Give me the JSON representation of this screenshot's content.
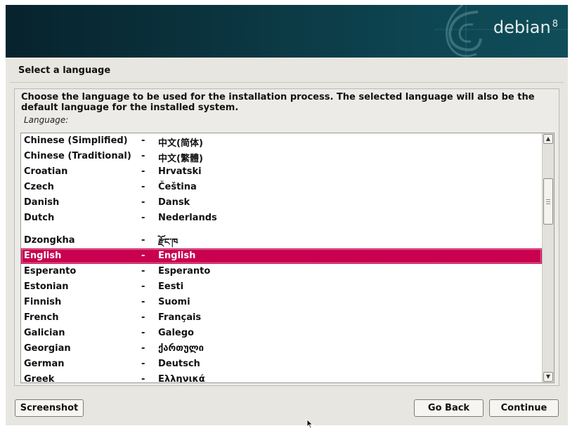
{
  "header": {
    "brand": "debian",
    "version": "8"
  },
  "page": {
    "title": "Select a language"
  },
  "prompt": {
    "instructions": "Choose the language to be used for the installation process. The selected language will also be the default language for the installed system.",
    "field_label": "Language:"
  },
  "languages": [
    {
      "name": "Chinese (Simplified)",
      "sep": "-",
      "native": "中文(简体)"
    },
    {
      "name": "Chinese (Traditional)",
      "sep": "-",
      "native": "中文(繁體)"
    },
    {
      "name": "Croatian",
      "sep": "-",
      "native": "Hrvatski"
    },
    {
      "name": "Czech",
      "sep": "-",
      "native": "Čeština"
    },
    {
      "name": "Danish",
      "sep": "-",
      "native": "Dansk"
    },
    {
      "name": "Dutch",
      "sep": "-",
      "native": "Nederlands"
    },
    {
      "name": "Dzongkha",
      "sep": "-",
      "native": "རྫོང་ཁ"
    },
    {
      "name": "English",
      "sep": "-",
      "native": "English"
    },
    {
      "name": "Esperanto",
      "sep": "-",
      "native": "Esperanto"
    },
    {
      "name": "Estonian",
      "sep": "-",
      "native": "Eesti"
    },
    {
      "name": "Finnish",
      "sep": "-",
      "native": "Suomi"
    },
    {
      "name": "French",
      "sep": "-",
      "native": "Français"
    },
    {
      "name": "Galician",
      "sep": "-",
      "native": "Galego"
    },
    {
      "name": "Georgian",
      "sep": "-",
      "native": "ქართული"
    },
    {
      "name": "German",
      "sep": "-",
      "native": "Deutsch"
    },
    {
      "name": "Greek",
      "sep": "-",
      "native": "Ελληνικά"
    }
  ],
  "selected_language": "English",
  "buttons": {
    "screenshot": "Screenshot",
    "go_back": "Go Back",
    "continue": "Continue"
  },
  "scrollbar": {
    "up_icon": "chevron-up-icon",
    "down_icon": "chevron-down-icon",
    "up_glyph": "▲",
    "down_glyph": "▼"
  },
  "colors": {
    "selection": "#c8004f",
    "banner": "#0b3540"
  }
}
